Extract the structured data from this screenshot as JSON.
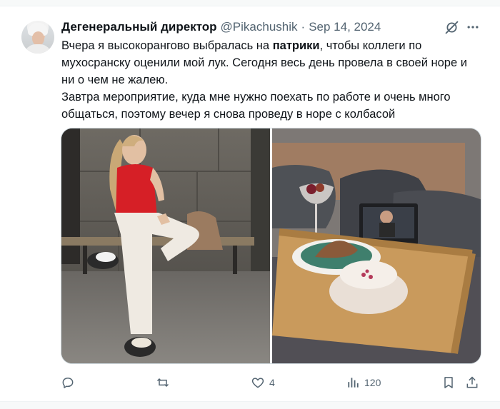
{
  "tweet": {
    "author_name": "Дегенеральный директор",
    "handle": "@Pikachushik",
    "separator": "·",
    "date": "Sep 14, 2024",
    "text_part1": "Вчера я высокорангово выбралась на ",
    "text_bold": "патрики",
    "text_part2": ", чтобы коллеги по мухосранску оценили мой лук. Сегодня весь день провела в своей норе и ни о чем не жалею.",
    "text_line2": "Завтра мероприятие, куда мне нужно поехать по работе и очень много общаться, поэтому вечер я снова проведу в норе с колбасой"
  },
  "icons": {
    "grok": "grok-icon",
    "more": "more-icon",
    "reply": "reply-icon",
    "retweet": "retweet-icon",
    "like": "heart-icon",
    "views": "views-icon",
    "bookmark": "bookmark-icon",
    "share": "share-icon"
  },
  "actions": {
    "reply_count": "",
    "retweet_count": "",
    "like_count": "4",
    "views_count": "120"
  },
  "colors": {
    "text": "#0f1419",
    "secondary": "#536471",
    "border": "#cfd9de"
  }
}
